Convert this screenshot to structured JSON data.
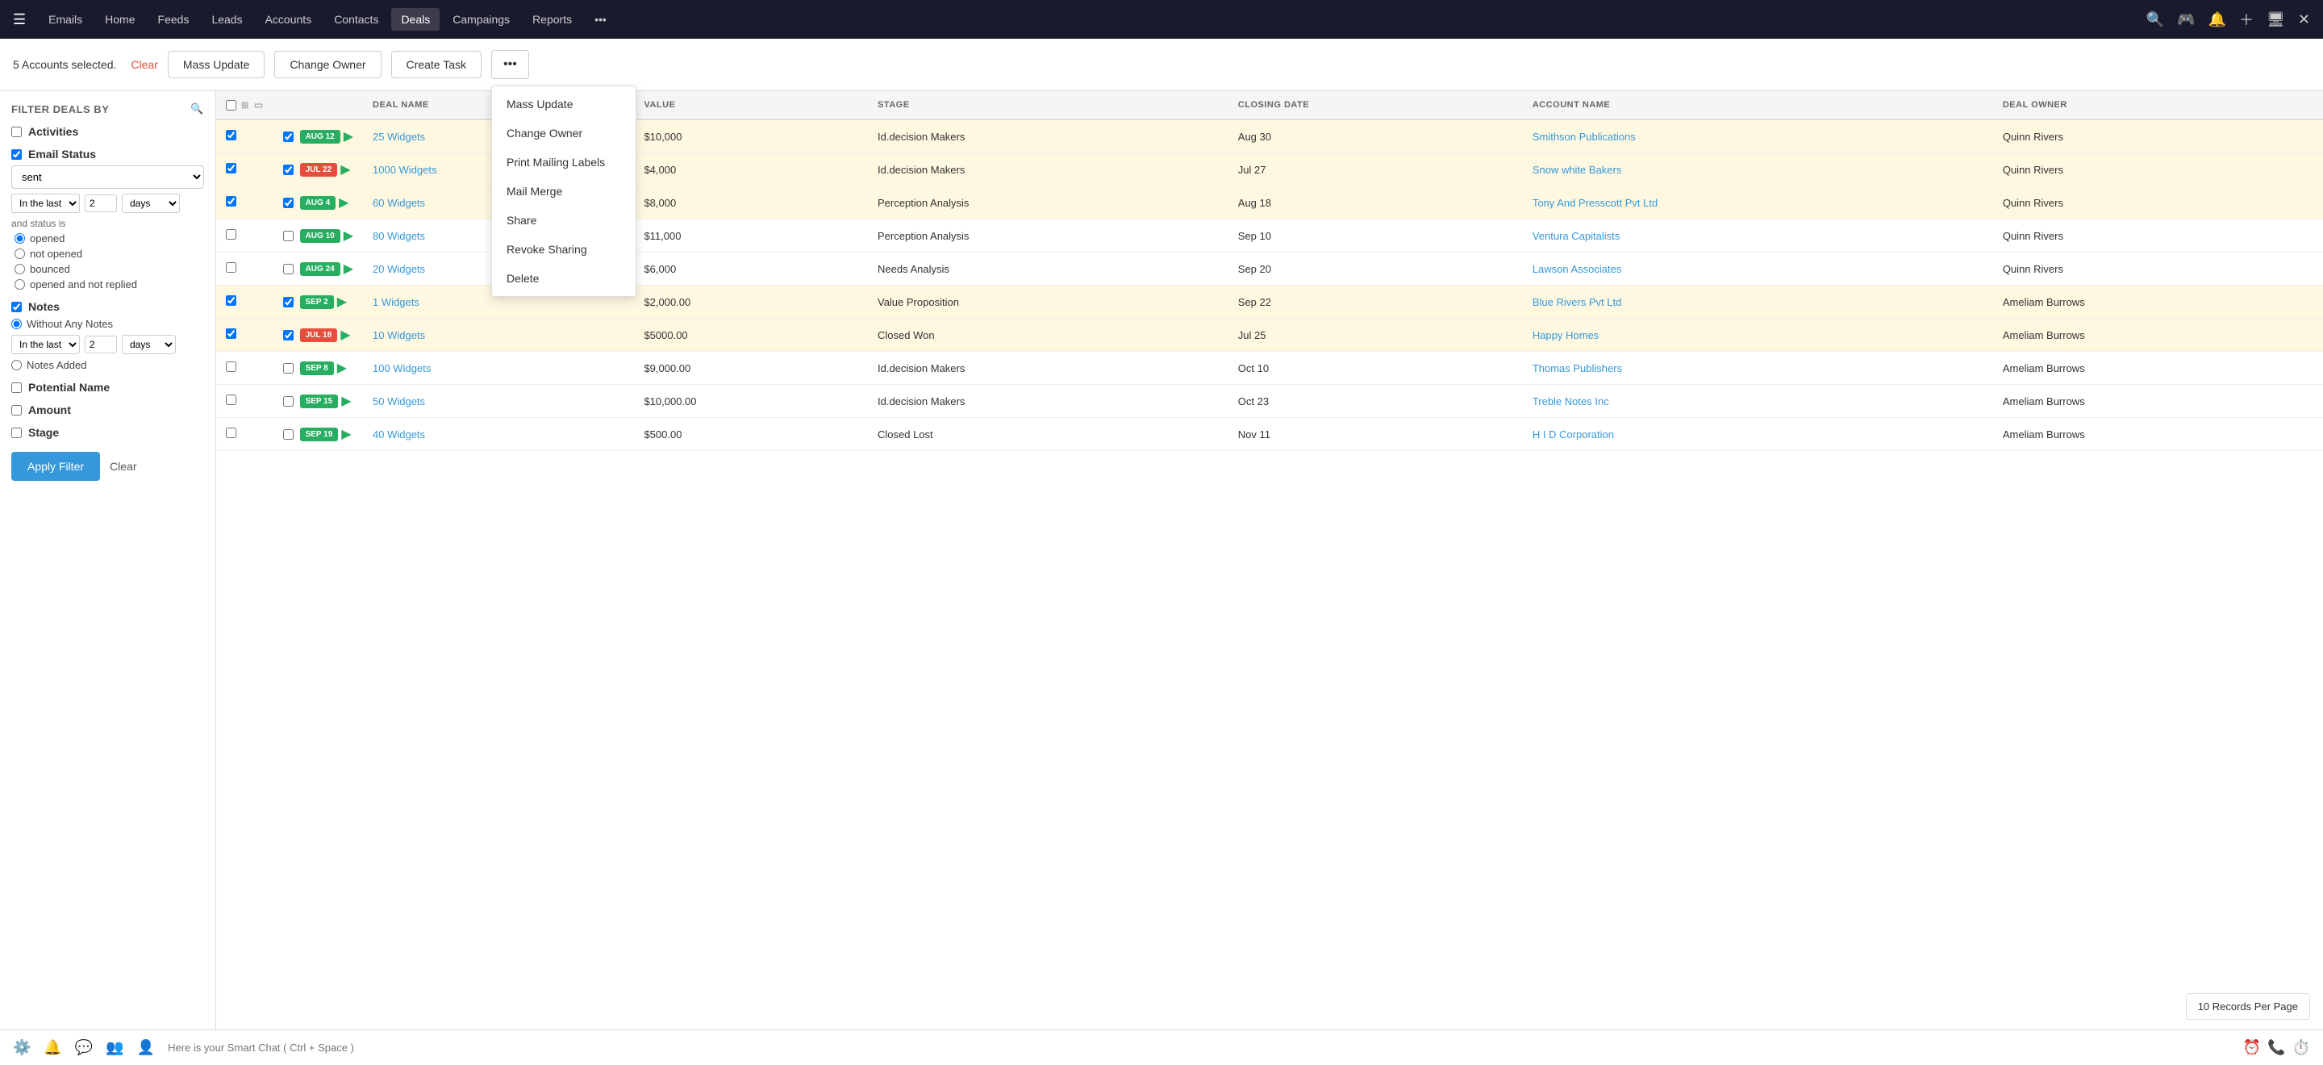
{
  "topnav": {
    "items": [
      {
        "label": "Emails",
        "active": false
      },
      {
        "label": "Home",
        "active": false
      },
      {
        "label": "Feeds",
        "active": false
      },
      {
        "label": "Leads",
        "active": false
      },
      {
        "label": "Accounts",
        "active": false
      },
      {
        "label": "Contacts",
        "active": false
      },
      {
        "label": "Deals",
        "active": true
      },
      {
        "label": "Campaings",
        "active": false
      },
      {
        "label": "Reports",
        "active": false
      },
      {
        "label": "•••",
        "active": false
      }
    ]
  },
  "action_bar": {
    "selected_count": "5 Accounts selected.",
    "clear_label": "Clear",
    "mass_update_label": "Mass Update",
    "change_owner_label": "Change Owner",
    "create_task_label": "Create Task"
  },
  "dropdown_menu": {
    "items": [
      {
        "label": "Mass Update"
      },
      {
        "label": "Change Owner"
      },
      {
        "label": "Print Mailing Labels"
      },
      {
        "label": "Mail Merge"
      },
      {
        "label": "Share"
      },
      {
        "label": "Revoke Sharing"
      },
      {
        "label": "Delete"
      }
    ]
  },
  "filter": {
    "title": "FILTER DEALS BY",
    "sections": [
      {
        "label": "Activities",
        "checked": false
      },
      {
        "label": "Email Status",
        "checked": true
      }
    ],
    "email_status_value": "sent",
    "in_the_last_label": "In the last",
    "in_the_last_value": "2",
    "days_label": "days",
    "and_status_is": "and status is",
    "radio_options": [
      {
        "label": "opened",
        "checked": true
      },
      {
        "label": "not opened",
        "checked": false
      },
      {
        "label": "bounced",
        "checked": false
      },
      {
        "label": "opened and not replied",
        "checked": false
      }
    ],
    "notes_label": "Notes",
    "notes_checked": true,
    "without_any_notes_label": "Without Any Notes",
    "without_notes_in_the_last_value": "2",
    "notes_added_label": "Notes Added",
    "potential_name_label": "Potential Name",
    "potential_checked": false,
    "amount_label": "Amount",
    "amount_checked": false,
    "stage_label": "Stage",
    "stage_checked": false,
    "apply_filter_label": "Apply Filter",
    "clear_label": "Clear"
  },
  "table": {
    "columns": [
      "",
      "",
      "DEAL NAME",
      "VALUE",
      "STAGE",
      "CLOSING DATE",
      "ACCOUNT NAME",
      "DEAL OWNER"
    ],
    "rows": [
      {
        "selected": true,
        "tag": "AUG 12",
        "tag_color": "green",
        "deal": "25 Widgets",
        "value": "$10,000",
        "stage": "Id.decision Makers",
        "closing": "Aug 30",
        "account": "Smithson Publications",
        "owner": "Quinn Rivers"
      },
      {
        "selected": true,
        "tag": "JUL 22",
        "tag_color": "red",
        "deal": "1000 Widgets",
        "value": "$4,000",
        "stage": "Id.decision Makers",
        "closing": "Jul 27",
        "account": "Snow white Bakers",
        "owner": "Quinn Rivers"
      },
      {
        "selected": true,
        "tag": "AUG 4",
        "tag_color": "green",
        "deal": "60 Widgets",
        "value": "$8,000",
        "stage": "Perception Analysis",
        "closing": "Aug 18",
        "account": "Tony And Presscott Pvt Ltd",
        "owner": "Quinn Rivers"
      },
      {
        "selected": false,
        "tag": "AUG 10",
        "tag_color": "green",
        "deal": "80 Widgets",
        "value": "$11,000",
        "stage": "Perception Analysis",
        "closing": "Sep 10",
        "account": "Ventura Capitalists",
        "owner": "Quinn Rivers"
      },
      {
        "selected": false,
        "tag": "AUG 24",
        "tag_color": "green",
        "deal": "20 Widgets",
        "value": "$6,000",
        "stage": "Needs Analysis",
        "closing": "Sep 20",
        "account": "Lawson Associates",
        "owner": "Quinn Rivers"
      },
      {
        "selected": true,
        "tag": "SEP 2",
        "tag_color": "green",
        "deal": "1 Widgets",
        "value": "$2,000.00",
        "stage": "Value Proposition",
        "closing": "Sep 22",
        "account": "Blue Rivers Pvt Ltd",
        "owner": "Ameliam Burrows"
      },
      {
        "selected": true,
        "tag": "JUL 18",
        "tag_color": "red",
        "deal": "10 Widgets",
        "value": "$5000.00",
        "stage": "Closed Won",
        "closing": "Jul 25",
        "account": "Happy Homes",
        "owner": "Ameliam Burrows"
      },
      {
        "selected": false,
        "tag": "SEP 8",
        "tag_color": "green",
        "deal": "100 Widgets",
        "value": "$9,000.00",
        "stage": "Id.decision Makers",
        "closing": "Oct 10",
        "account": "Thomas Publishers",
        "owner": "Ameliam Burrows"
      },
      {
        "selected": false,
        "tag": "SEP 15",
        "tag_color": "green",
        "deal": "50 Widgets",
        "value": "$10,000.00",
        "stage": "Id.decision Makers",
        "closing": "Oct 23",
        "account": "Treble Notes Inc",
        "owner": "Ameliam Burrows"
      },
      {
        "selected": false,
        "tag": "SEP 19",
        "tag_color": "green",
        "deal": "40 Widgets",
        "value": "$500.00",
        "stage": "Closed Lost",
        "closing": "Nov 11",
        "account": "H I D Corporation",
        "owner": "Ameliam Burrows"
      }
    ]
  },
  "pagination": {
    "records_per_page": "10 Records Per Page"
  },
  "bottom_bar": {
    "chat_placeholder": "Here is your Smart Chat ( Ctrl + Space )"
  }
}
